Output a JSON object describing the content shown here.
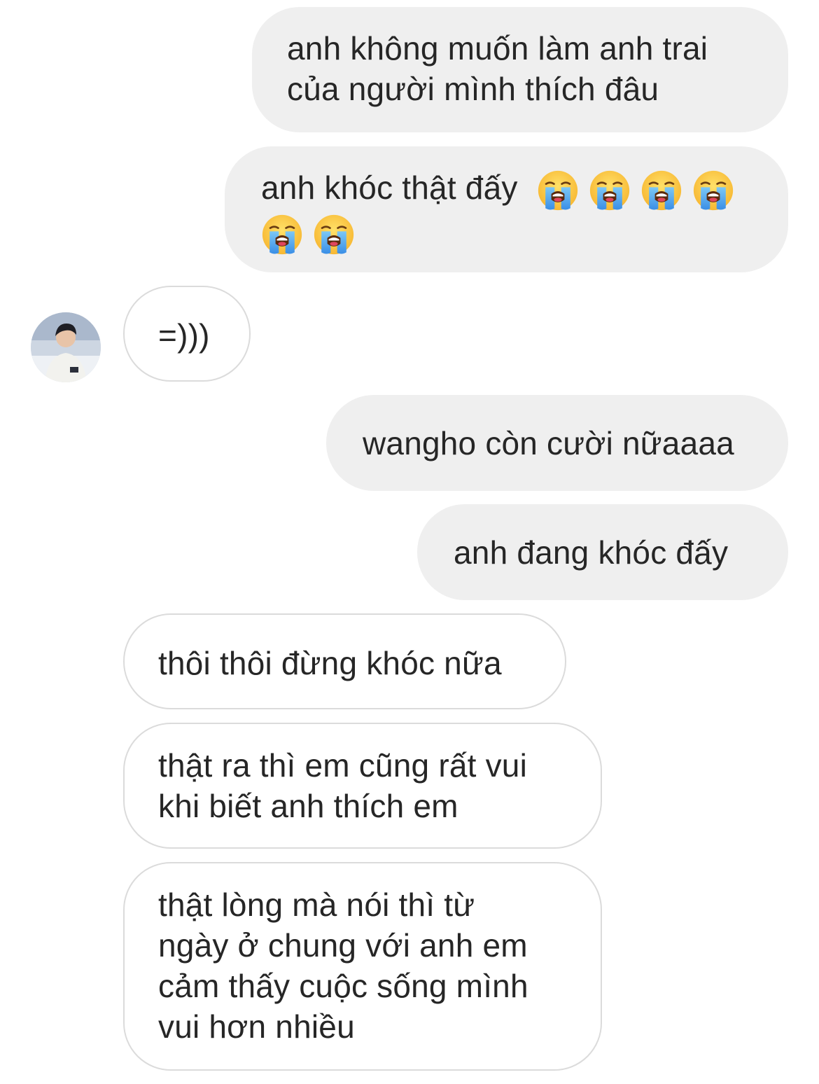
{
  "conversation": {
    "messages": [
      {
        "direction": "sent",
        "lines": [
          "anh không muốn làm anh trai",
          "của người mình thích đâu"
        ]
      },
      {
        "direction": "sent",
        "text": "anh khóc thật đấy",
        "emoji": "loudly-crying-face",
        "emoji_count": 6
      },
      {
        "direction": "received",
        "text": "=)))"
      },
      {
        "direction": "sent",
        "text": "wangho còn cười nữaaaa"
      },
      {
        "direction": "sent",
        "text": "anh đang khóc đấy"
      },
      {
        "direction": "received",
        "text": "thôi thôi đừng khóc nữa"
      },
      {
        "direction": "received",
        "lines": [
          "thật ra thì em cũng rất vui",
          "khi biết anh thích em"
        ]
      },
      {
        "direction": "received",
        "lines": [
          "thật lòng mà nói thì từ",
          "ngày ở chung với anh em",
          "cảm thấy cuộc sống mình",
          "vui hơn nhiều"
        ]
      }
    ]
  },
  "theme": {
    "sent_bubble_bg": "#efefef",
    "received_bubble_border": "#dbdbdb",
    "text_color": "#262626"
  }
}
